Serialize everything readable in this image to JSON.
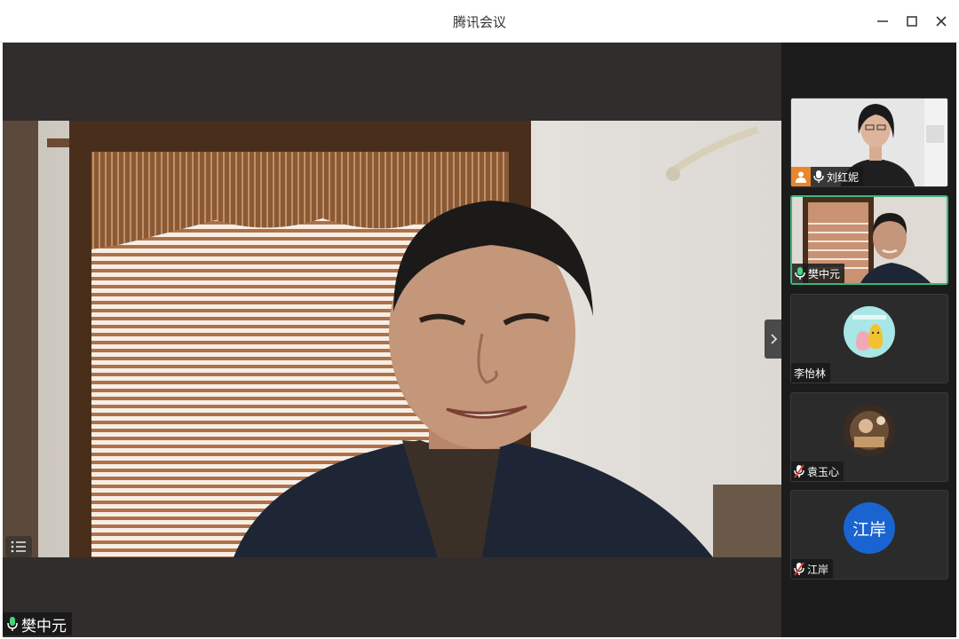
{
  "app": {
    "title": "腾讯会议"
  },
  "window_controls": {
    "minimize": "minimize",
    "maximize": "maximize",
    "close": "close"
  },
  "main_speaker": {
    "name": "樊中元",
    "mic": "on"
  },
  "participants": [
    {
      "name": "刘红妮",
      "mic": "on",
      "host": true,
      "video": true
    },
    {
      "name": "樊中元",
      "mic": "on",
      "host": false,
      "video": true,
      "active": true
    },
    {
      "name": "李怡林",
      "mic": "none",
      "host": false,
      "video": false
    },
    {
      "name": "袁玉心",
      "mic": "muted",
      "host": false,
      "video": false
    },
    {
      "name": "江岸",
      "mic": "muted",
      "host": false,
      "video": false,
      "avatar_text": "江岸"
    }
  ],
  "colors": {
    "active_border": "#3fb57a",
    "mic_on": "#3fd77d",
    "mic_muted": "#e53935",
    "host_badge": "#e9862b",
    "text_avatar": "#1a64d1"
  }
}
